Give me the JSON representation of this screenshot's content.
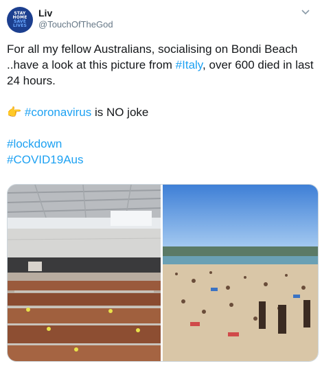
{
  "author": {
    "name": "Liv",
    "handle": "@TouchOfTheGod",
    "avatar_lines": [
      "STAY",
      "HOME",
      "SAVE",
      "LIVES"
    ]
  },
  "tweet": {
    "line1_prefix": "For all my fellow Australians, socialising on Bondi Beach ..have a look at this picture from ",
    "hashtag_italy": "#Italy",
    "line1_suffix": ", over 600 died in last 24 hours.",
    "pointing_emoji": "👉",
    "hashtag_coronavirus": "#coronavirus",
    "no_joke_text": " is NO joke",
    "hashtag_lockdown": "#lockdown",
    "hashtag_covid": "#COVID19Aus"
  },
  "media": {
    "left_photo": "hangar-coffins-photo",
    "right_photo": "bondi-beach-crowd-photo"
  },
  "colors": {
    "link": "#1da1f2",
    "text": "#14171a",
    "secondary": "#657786",
    "avatar_bg": "#1c3f8f"
  }
}
